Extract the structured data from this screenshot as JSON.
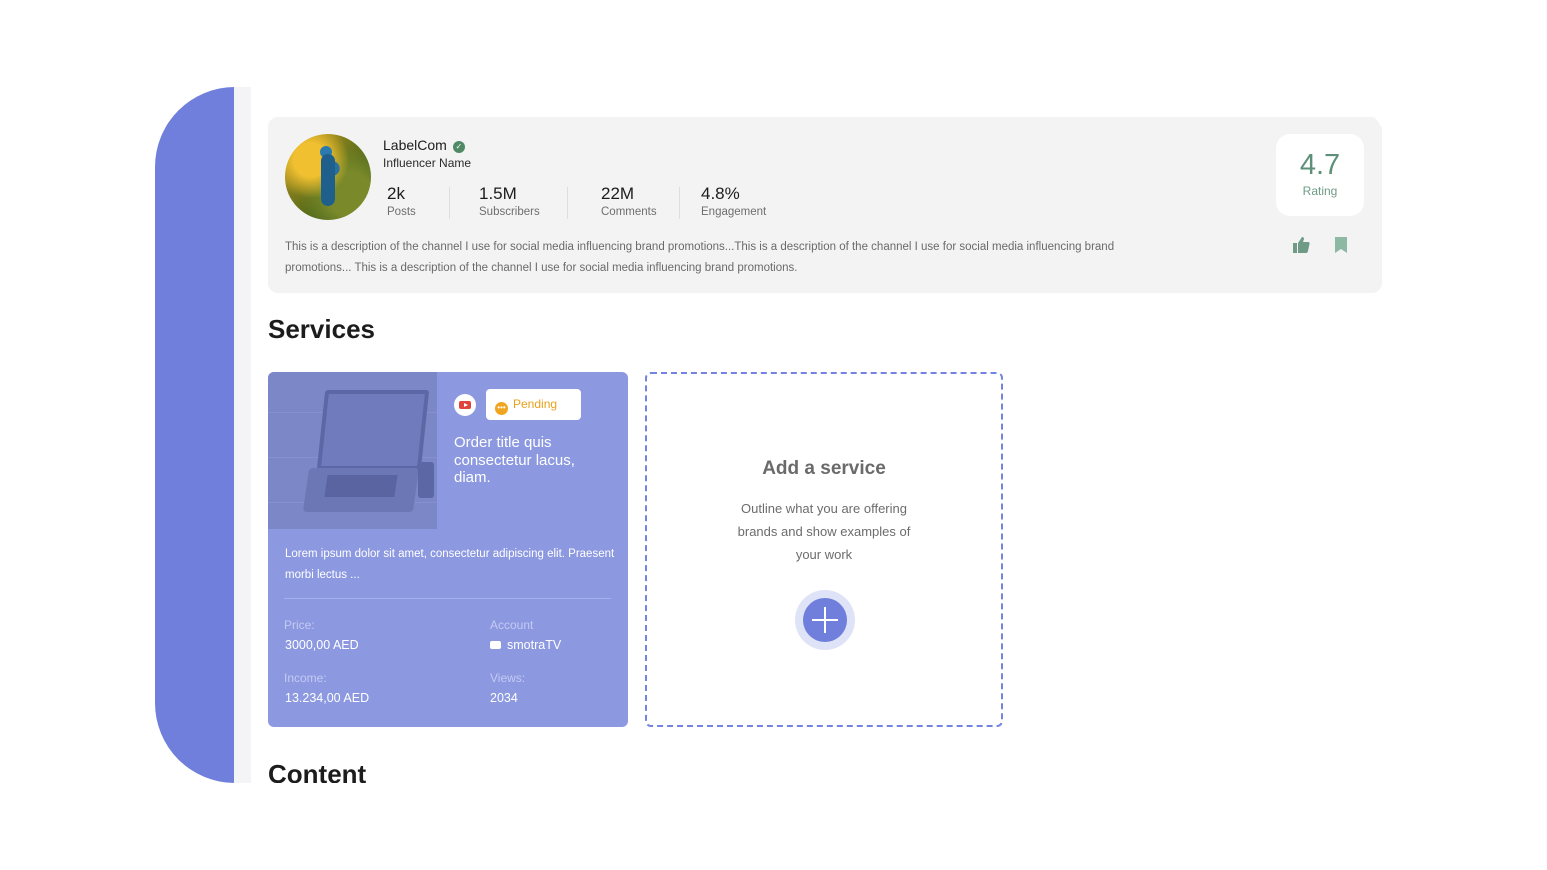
{
  "profile": {
    "name": "LabelCom",
    "subtitle": "Influencer Name",
    "stats": [
      {
        "value": "2k",
        "label": "Posts"
      },
      {
        "value": "1.5M",
        "label": "Subscribers"
      },
      {
        "value": "22M",
        "label": "Comments"
      },
      {
        "value": "4.8%",
        "label": "Engagement"
      }
    ],
    "description": "This is a description of the channel I use for social media influencing brand promotions...This is a description of the channel I use for social media influencing brand promotions... This is a description of the channel I use for social media influencing brand promotions.",
    "rating": {
      "value": "4.7",
      "label": "Rating"
    }
  },
  "services": {
    "title": "Services",
    "card": {
      "status": "Pending",
      "title": "Order title quis consectetur lacus, diam.",
      "description": "Lorem ipsum dolor sit amet, consectetur adipiscing elit. Praesent morbi lectus ...",
      "price_label": "Price:",
      "price_value": "3000,00 AED",
      "account_label": "Account",
      "account_value": "smotraTV",
      "income_label": "Income:",
      "income_value": "13.234,00 AED",
      "views_label": "Views:",
      "views_value": "2034"
    },
    "add": {
      "title": "Add a service",
      "description": "Outline what you are offering brands and show examples of your work"
    }
  },
  "content": {
    "title": "Content"
  },
  "colors": {
    "accent": "#6f7fdb",
    "card_bg": "#8c98e0",
    "rating_green": "#5e8f78",
    "pending": "#f0a51e",
    "youtube_red": "#e0453b"
  },
  "icons": [
    "verified-icon",
    "thumbs-up-icon",
    "bookmark-icon",
    "youtube-icon",
    "pending-icon",
    "plus-icon"
  ]
}
